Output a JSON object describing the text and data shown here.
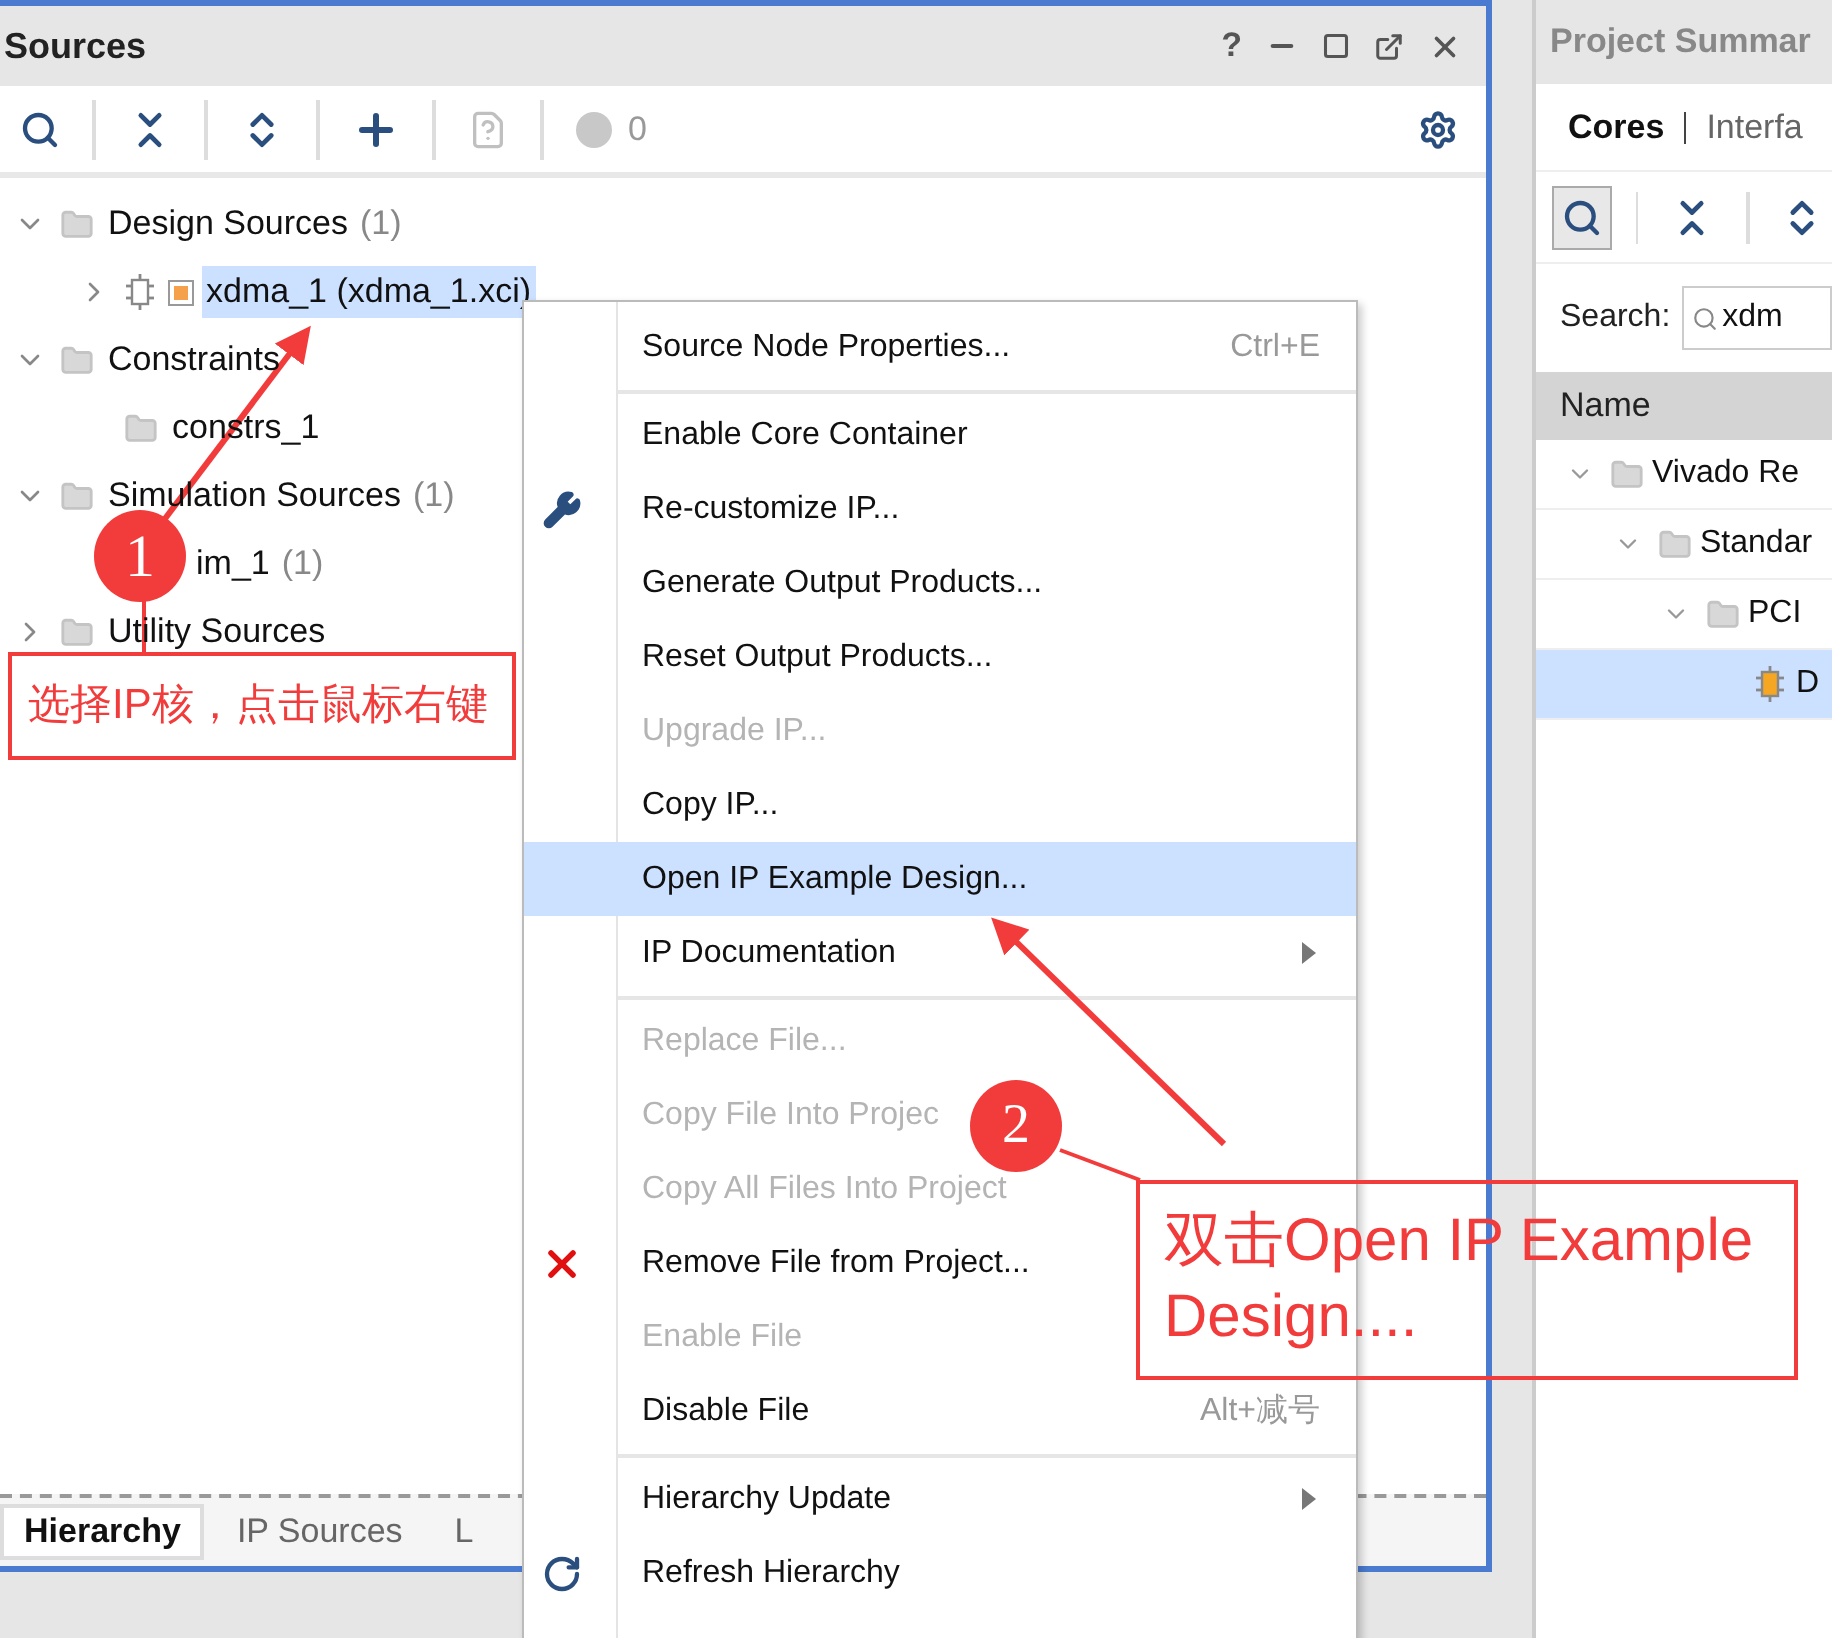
{
  "sources_panel": {
    "title": "Sources",
    "title_buttons": [
      {
        "kind": "help",
        "label": "?"
      },
      {
        "kind": "minimize"
      },
      {
        "kind": "maximize"
      },
      {
        "kind": "float"
      },
      {
        "kind": "close"
      }
    ],
    "toolbar": [
      {
        "kind": "search",
        "disabled": false
      },
      {
        "kind": "collapse",
        "disabled": false
      },
      {
        "kind": "expand",
        "disabled": false
      },
      {
        "kind": "add",
        "disabled": false
      },
      {
        "kind": "help-doc",
        "disabled": true
      },
      {
        "kind": "status",
        "disabled": true,
        "label": "0"
      }
    ],
    "tree": [
      {
        "label": "Design Sources",
        "count": "(1)",
        "kind": "folder",
        "expanded": true,
        "selected": false,
        "children": [
          {
            "label": "xdma_1 (xdma_1.xci)",
            "kind": "ip",
            "expanded": false,
            "selected": true
          }
        ]
      },
      {
        "label": "Constraints",
        "kind": "folder",
        "expanded": true,
        "selected": false,
        "children": [
          {
            "label": "constrs_1",
            "kind": "folder",
            "selected": false
          }
        ]
      },
      {
        "label": "Simulation Sources",
        "count": "(1)",
        "kind": "folder",
        "expanded": true,
        "selected": false,
        "children": [
          {
            "label": "im_1",
            "count": "(1)",
            "kind": "covered",
            "selected": false
          }
        ]
      },
      {
        "label": "Utility Sources",
        "kind": "folder",
        "expanded": false,
        "selected": false
      }
    ],
    "tabs": [
      {
        "label": "Hierarchy",
        "selected": true
      },
      {
        "label": "IP Sources",
        "selected": false
      },
      {
        "label": "L",
        "selected": false
      }
    ]
  },
  "catalog_panel": {
    "title": "Project Summar",
    "tabs": [
      {
        "label": "Cores",
        "selected": true
      },
      {
        "label": "Interfa",
        "selected": false
      }
    ],
    "toolbar": [
      {
        "kind": "search",
        "selected": true
      },
      {
        "kind": "collapse",
        "selected": false
      },
      {
        "kind": "expand",
        "selected": false
      }
    ],
    "search": {
      "label": "Search:",
      "value": "xdm"
    },
    "column": "Name",
    "tree": [
      {
        "label": "Vivado Re",
        "kind": "folder",
        "expanded": true,
        "selected": false,
        "children": [
          {
            "label": "Standar",
            "kind": "folder",
            "expanded": true,
            "selected": false,
            "children": [
              {
                "label": "PCI",
                "kind": "folder",
                "expanded": true,
                "selected": false,
                "children": [
                  {
                    "label": "D",
                    "kind": "ip",
                    "selected": true
                  }
                ]
              }
            ]
          }
        ]
      }
    ]
  },
  "context_menu": {
    "groups": [
      [
        {
          "label": "Source Node Properties...",
          "shortcut": "Ctrl+E",
          "disabled": false,
          "selected": false
        }
      ],
      [
        {
          "label": "Enable Core Container",
          "disabled": false,
          "selected": false
        },
        {
          "label": "Re-customize IP...",
          "kind": "wrench",
          "disabled": false,
          "selected": false
        },
        {
          "label": "Generate Output Products...",
          "disabled": false,
          "selected": false
        },
        {
          "label": "Reset Output Products...",
          "disabled": false,
          "selected": false
        },
        {
          "label": "Upgrade IP...",
          "disabled": true,
          "selected": false
        },
        {
          "label": "Copy IP...",
          "disabled": false,
          "selected": false
        },
        {
          "label": "Open IP Example Design...",
          "disabled": false,
          "selected": true
        },
        {
          "label": "IP Documentation",
          "submenu": true,
          "disabled": false,
          "selected": false
        }
      ],
      [
        {
          "label": "Replace File...",
          "disabled": true,
          "selected": false
        },
        {
          "label": "Copy File Into Projec",
          "disabled": true,
          "selected": false
        },
        {
          "label": "Copy All Files Into Project",
          "disabled": true,
          "selected": false
        },
        {
          "label": "Remove File from Project...",
          "kind": "remove",
          "disabled": false,
          "selected": false
        },
        {
          "label": "Enable File",
          "disabled": true,
          "selected": false
        },
        {
          "label": "Disable File",
          "shortcut": "Alt+减号",
          "disabled": false,
          "selected": false
        }
      ],
      [
        {
          "label": "Hierarchy Update",
          "submenu": true,
          "disabled": false,
          "selected": false
        },
        {
          "label": "Refresh Hierarchy",
          "kind": "refresh",
          "disabled": false,
          "selected": false
        }
      ]
    ]
  },
  "annotations": [
    {
      "number": "1",
      "text": "选择IP核，点击鼠标右键"
    },
    {
      "number": "2",
      "text": "双击Open IP Example Design...."
    }
  ]
}
